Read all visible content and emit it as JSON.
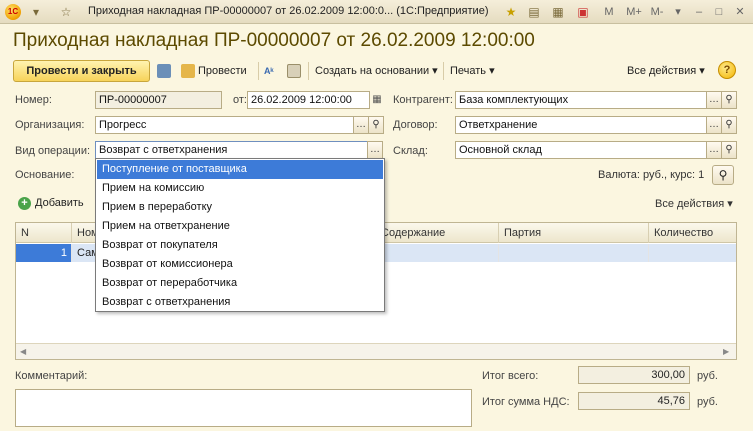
{
  "titlebar": {
    "app_logo": "1С",
    "title": "Приходная накладная ПР-00000007 от 26.02.2009 12:00:0... (1С:Предприятие)",
    "right_icons": [
      "M",
      "M+",
      "M-"
    ]
  },
  "doc_title": "Приходная накладная ПР-00000007 от 26.02.2009 12:00:00",
  "toolbar": {
    "post_close": "Провести и закрыть",
    "post": "Провести",
    "create_based": "Создать на основании ▾",
    "print": "Печать ▾",
    "all_actions": "Все действия ▾",
    "help": "?"
  },
  "form": {
    "number_label": "Номер:",
    "number_value": "ПР-00000007",
    "date_label": "от:",
    "date_value": "26.02.2009 12:00:00",
    "contractor_label": "Контрагент:",
    "contractor_value": "База комплектующих",
    "org_label": "Организация:",
    "org_value": "Прогресс",
    "contract_label": "Договор:",
    "contract_value": "Ответхранение",
    "op_label": "Вид операции:",
    "op_value": "Возврат с ответхранения",
    "warehouse_label": "Склад:",
    "warehouse_value": "Основной склад",
    "basis_label": "Основание:",
    "currency": "Валюта: руб., курс: 1"
  },
  "goods": {
    "add": "Добавить",
    "all_actions": "Все действия ▾",
    "columns": [
      "N",
      "Ном",
      "Содержание",
      "Партия",
      "Количество"
    ],
    "row": {
      "n": "1",
      "name": "Сам"
    }
  },
  "dropdown": {
    "items": [
      "Поступление от поставщика",
      "Прием на комиссию",
      "Прием в переработку",
      "Прием на ответхранение",
      "Возврат от покупателя",
      "Возврат от комиссионера",
      "Возврат от переработчика",
      "Возврат с ответхранения"
    ],
    "selected_index": 0
  },
  "footer": {
    "comment_label": "Комментарий:",
    "total_label": "Итог всего:",
    "total_value": "300,00",
    "vat_label": "Итог сумма НДС:",
    "vat_value": "45,76",
    "currency": "руб."
  }
}
